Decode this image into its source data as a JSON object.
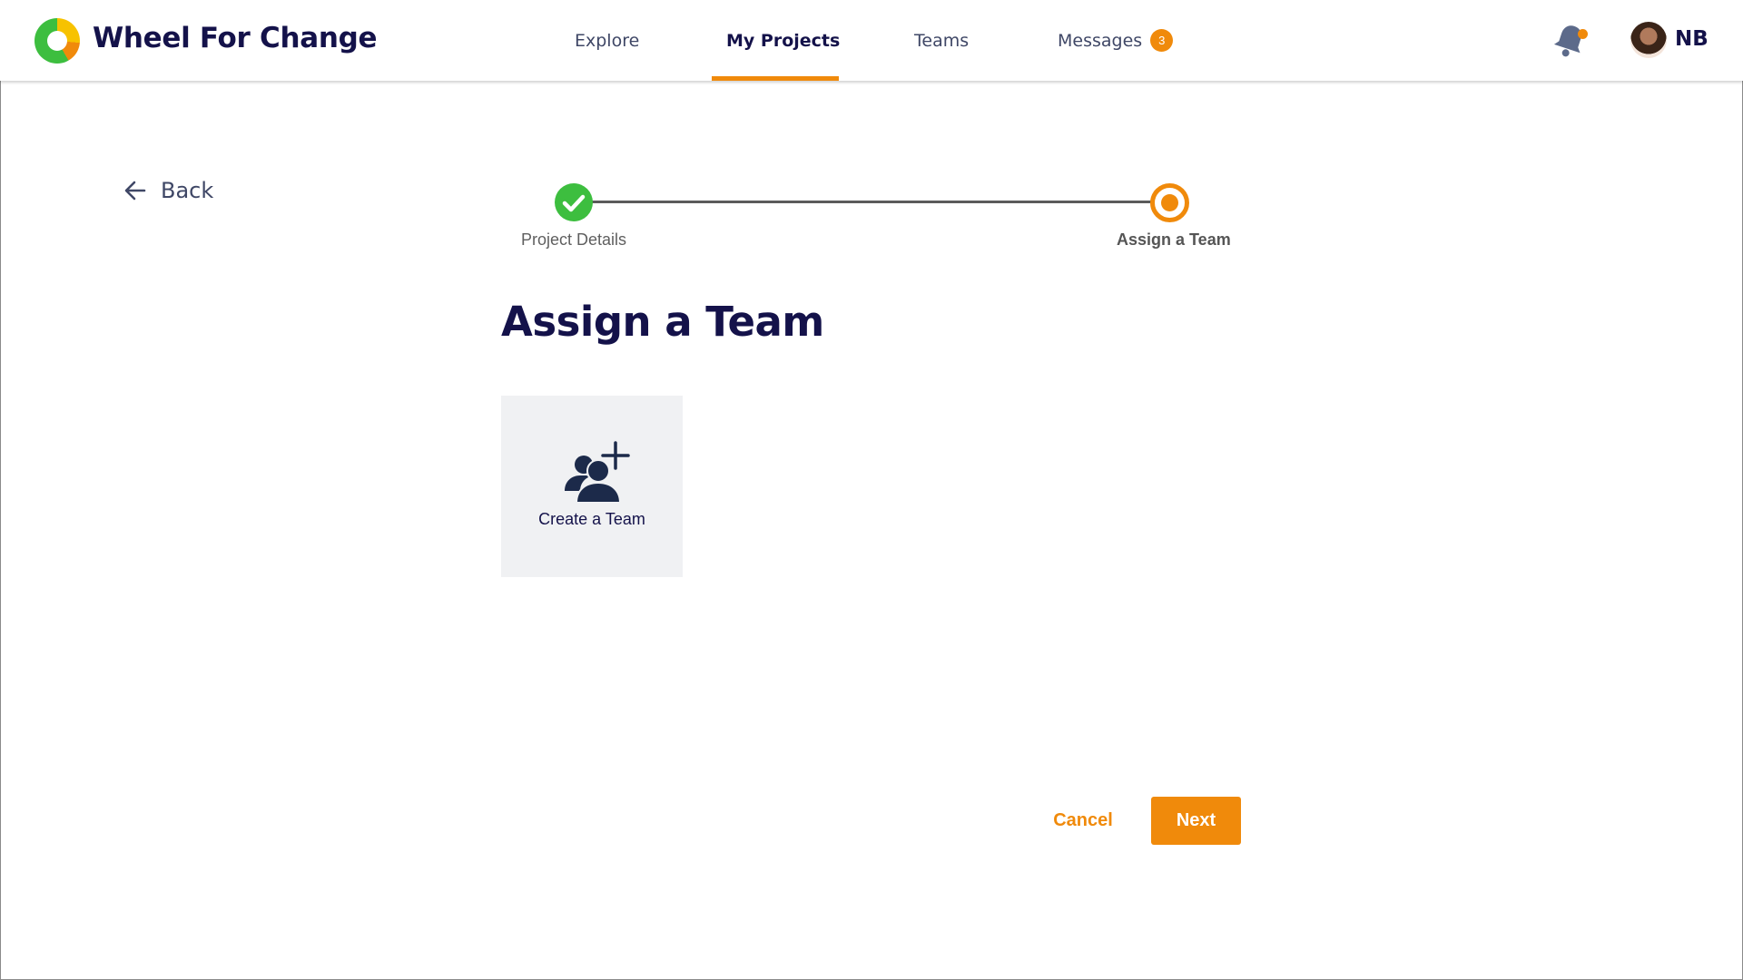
{
  "app": {
    "brand_name": "Wheel For Change",
    "logo_icon": "wheel-logo-icon",
    "colors": {
      "accent": "#f08a0b",
      "success": "#3dbe3f",
      "navy": "#14124a",
      "card_bg": "#f0f1f3"
    }
  },
  "nav": {
    "items": [
      {
        "label": "Explore"
      },
      {
        "label": "My Projects",
        "active": true
      },
      {
        "label": "Teams"
      },
      {
        "label": "Messages",
        "badge": "3"
      }
    ]
  },
  "user": {
    "initials": "NB",
    "notification_icon": "bell-icon",
    "has_unread_notifications": true
  },
  "back": {
    "label": "Back",
    "icon": "arrow-left-icon"
  },
  "stepper": {
    "steps": [
      {
        "label": "Project Details",
        "status": "complete"
      },
      {
        "label": "Assign a Team",
        "status": "current"
      }
    ]
  },
  "page": {
    "title": "Assign a Team"
  },
  "create_team_card": {
    "label": "Create a Team",
    "icon": "add-team-icon"
  },
  "actions": {
    "cancel_label": "Cancel",
    "next_label": "Next"
  }
}
